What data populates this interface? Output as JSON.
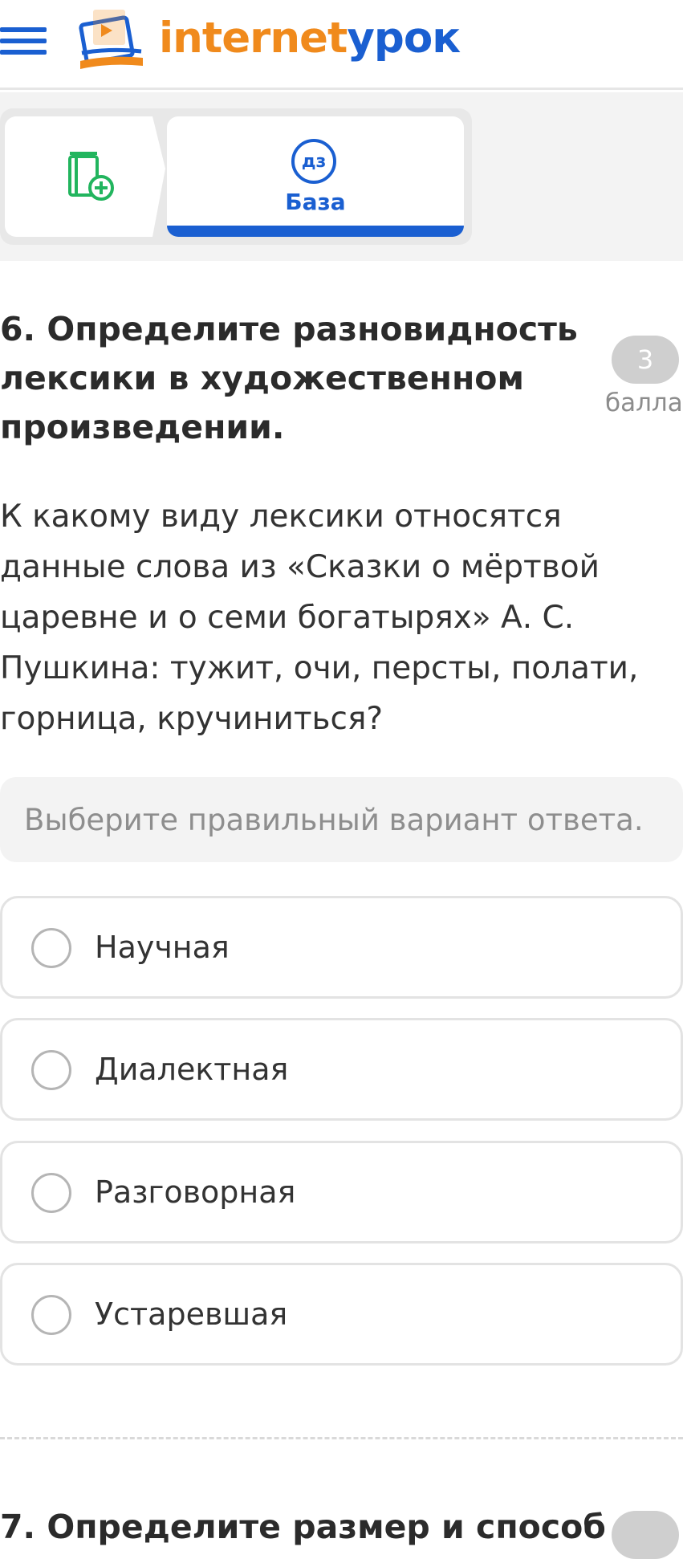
{
  "header": {
    "logo_part1": "internet",
    "logo_part2": "урок",
    "brand_colors": {
      "orange": "#f08a1c",
      "blue": "#1a5fd1"
    }
  },
  "tabs": {
    "active_badge": "дз",
    "active_label": "База"
  },
  "question": {
    "title": "6. Определите разновидность лексики в художественном произведении.",
    "points": "3",
    "points_label": "балла",
    "text": "К какому виду лексики относятся данные слова из «Сказки о мёртвой царевне и о семи богатырях» А. С. Пушкина: тужит, очи, персты, полати, горница, кручиниться?",
    "hint": "Выберите правильный вариант ответа.",
    "options": [
      "Научная",
      "Диалектная",
      "Разговорная",
      "Устаревшая"
    ]
  },
  "next_question": {
    "title": "7. Определите размер и способ"
  }
}
